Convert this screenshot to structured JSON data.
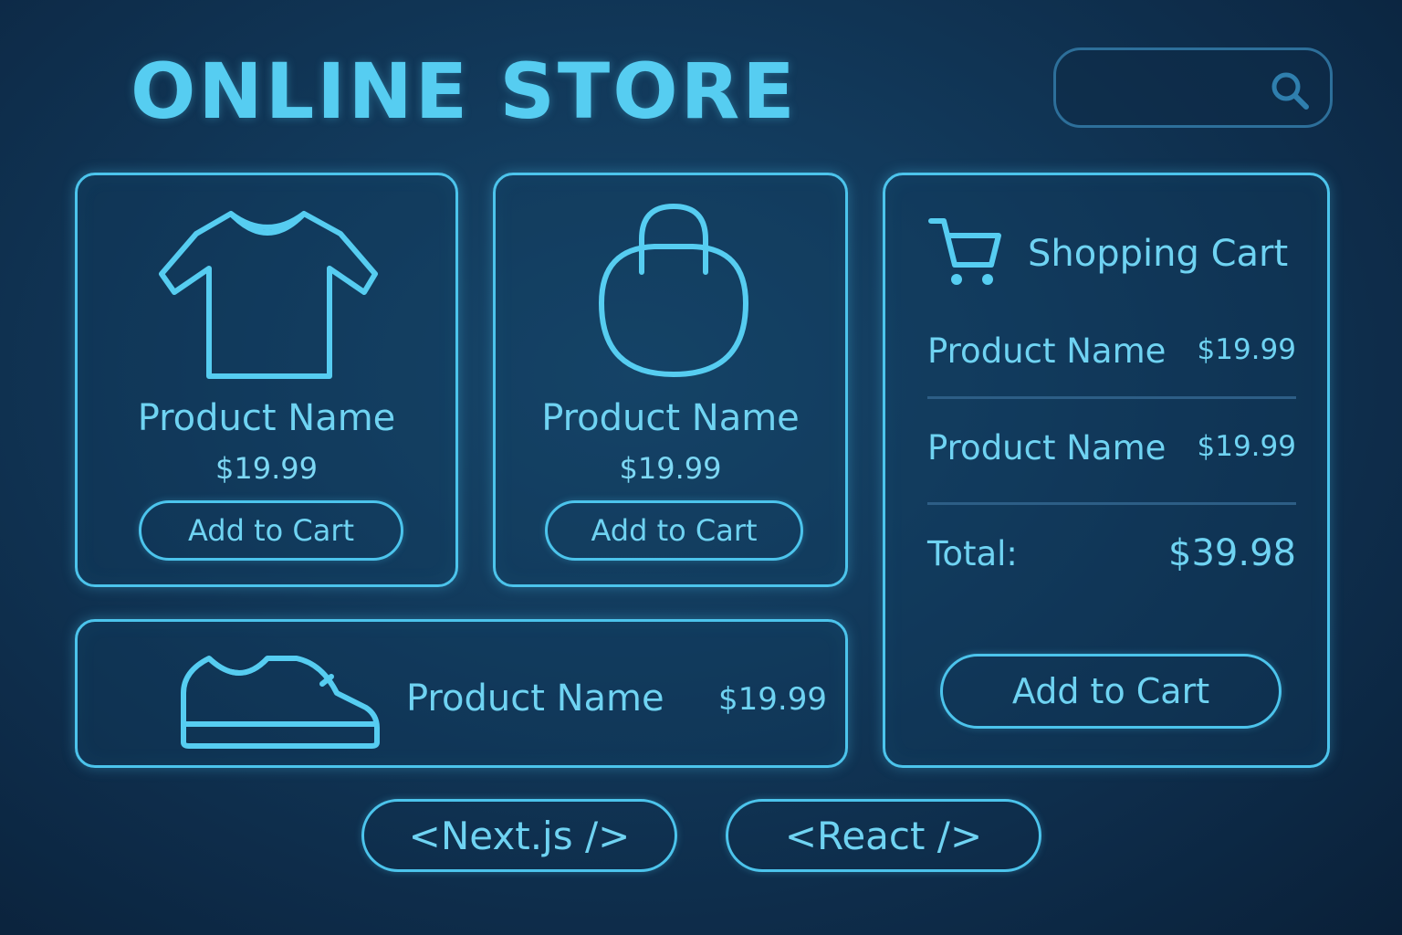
{
  "header": {
    "title": "ONLINE STORE",
    "search_placeholder": ""
  },
  "products": [
    {
      "icon": "tshirt-icon",
      "name": "Product Name",
      "price": "$19.99",
      "button_label": "Add to Cart"
    },
    {
      "icon": "shopping-bag-icon",
      "name": "Product Name",
      "price": "$19.99",
      "button_label": "Add to Cart"
    },
    {
      "icon": "sneaker-icon",
      "name": "Product Name",
      "price": "$19.99"
    }
  ],
  "cart": {
    "icon": "shopping-cart-icon",
    "title": "Shopping Cart",
    "items": [
      {
        "name": "Product Name",
        "price": "$19.99"
      },
      {
        "name": "Product Name",
        "price": "$19.99"
      }
    ],
    "total_label": "Total:",
    "total_value": "$39.98",
    "button_label": "Add to Cart"
  },
  "footer": {
    "buttons": [
      {
        "label": "<Next.js />"
      },
      {
        "label": "<React />"
      }
    ]
  },
  "colors": {
    "accent": "#4cc4ec",
    "text": "#6fd3f2",
    "background": "#0d2a47"
  }
}
